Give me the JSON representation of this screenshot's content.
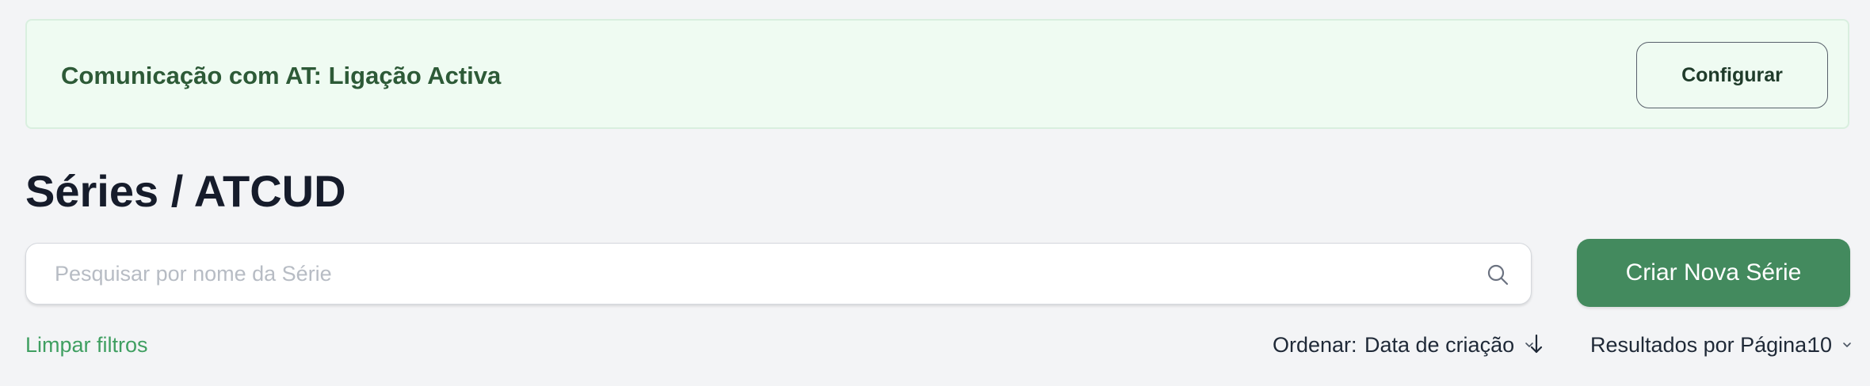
{
  "banner": {
    "text": "Comunicação com AT: Ligação Activa",
    "configure_label": "Configurar"
  },
  "page": {
    "title": "Séries / ATCUD"
  },
  "search": {
    "placeholder": "Pesquisar por nome da Série",
    "value": "",
    "icon": "search-icon"
  },
  "actions": {
    "create_label": "Criar Nova Série"
  },
  "filters": {
    "clear_label": "Limpar filtros",
    "sort_label": "Ordenar:",
    "sort_value": "Data de criação",
    "sort_direction": "descending",
    "per_page_label": "Resultados por Página:",
    "per_page_value": "10"
  },
  "colors": {
    "banner_bg": "#effbf2",
    "banner_text": "#2d5a37",
    "primary_button": "#438a5e",
    "link": "#3f9f61",
    "page_bg": "#f3f4f6"
  }
}
